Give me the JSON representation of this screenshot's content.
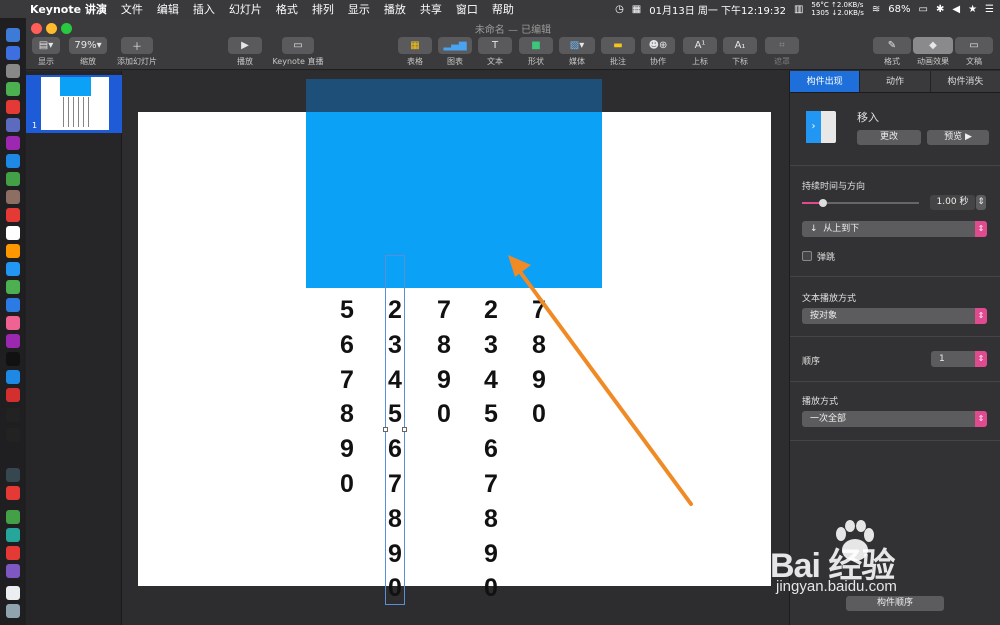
{
  "menubar": {
    "app_name": "Keynote 讲演",
    "items": [
      "文件",
      "编辑",
      "插入",
      "幻灯片",
      "格式",
      "排列",
      "显示",
      "播放",
      "共享",
      "窗口",
      "帮助"
    ],
    "temp": "56°C",
    "fan": "1305",
    "net_up": "↑2.0KB/s",
    "net_down": "↓2.0KB/s",
    "datetime": "01月13日 周一 下午12:19:32",
    "battery": "68%"
  },
  "window": {
    "title": "未命名",
    "title_suffix": " — 已编辑"
  },
  "toolbar": {
    "view": "显示",
    "zoom_value": "79%",
    "zoom_label": "缩放",
    "add_slide": "添加幻灯片",
    "play": "播放",
    "keynote_live": "Keynote 直播",
    "table": "表格",
    "chart": "图表",
    "text": "文本",
    "shape": "形状",
    "media": "媒体",
    "comment": "批注",
    "collaborate": "协作",
    "superscript": "上标",
    "subscript": "下标",
    "mask": "遮罩",
    "format": "格式",
    "animate": "动画效果",
    "document": "文稿"
  },
  "navigator": {
    "slide_number": "1"
  },
  "slide": {
    "columns": [
      [
        "5",
        "6",
        "7",
        "8",
        "9",
        "0"
      ],
      [
        "2",
        "3",
        "4",
        "5",
        "6",
        "7",
        "8",
        "9",
        "0"
      ],
      [
        "7",
        "8",
        "9",
        "0"
      ],
      [
        "2",
        "3",
        "4",
        "5",
        "6",
        "7",
        "8",
        "9",
        "0"
      ],
      [
        "7",
        "8",
        "9",
        "0"
      ]
    ]
  },
  "inspector": {
    "tabs": [
      "构件出现",
      "动作",
      "构件消失"
    ],
    "effect_name": "移入",
    "change_button": "更改",
    "preview_button": "预览",
    "duration_label": "持续时间与方向",
    "duration_value": "1.00 秒",
    "direction": "从上到下",
    "bounce_label": "弹跳",
    "text_delivery_label": "文本播放方式",
    "text_delivery_value": "按对象",
    "order_label": "顺序",
    "order_value": "1",
    "delivery_label": "播放方式",
    "delivery_value": "一次全部",
    "build_order_button": "构件顺序"
  },
  "watermark": {
    "brand": "Bai 经验",
    "url": "jingyan.baidu.com"
  },
  "colors": {
    "accent": "#1e6fd9",
    "shape_blue": "#0ba1f6",
    "arrow_orange": "#f08a24",
    "slider_pink": "#e04a8f"
  }
}
